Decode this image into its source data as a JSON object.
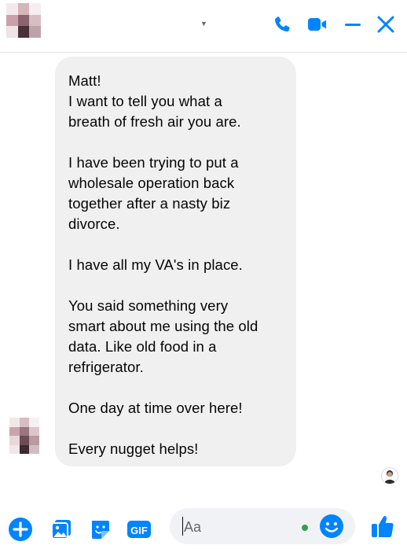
{
  "header": {
    "contact_avatar": "blurred-avatar",
    "contact_name": "",
    "icons": [
      "phone-icon",
      "video-camera-icon",
      "minimize-icon",
      "close-icon"
    ],
    "accent_color": "#0084ff"
  },
  "messages": [
    {
      "from": "contact",
      "paragraphs": [
        "Matt!\nI want to tell you what a\nbreath of fresh air you are.",
        "I have been trying to put a\nwholesale operation back\ntogether after a nasty biz\ndivorce.",
        "I have all my VA's in place.",
        "You said something very\nsmart about me using the old\ndata.   Like old food in a\nrefrigerator.",
        "One day at time over here!",
        "Every nugget helps!"
      ]
    }
  ],
  "composer": {
    "placeholder": "Aa",
    "gif_label": "GIF",
    "icons": [
      "plus-circle-icon",
      "photo-icon",
      "sticker-icon",
      "gif-icon",
      "emoji-icon",
      "thumbs-up-icon"
    ]
  }
}
